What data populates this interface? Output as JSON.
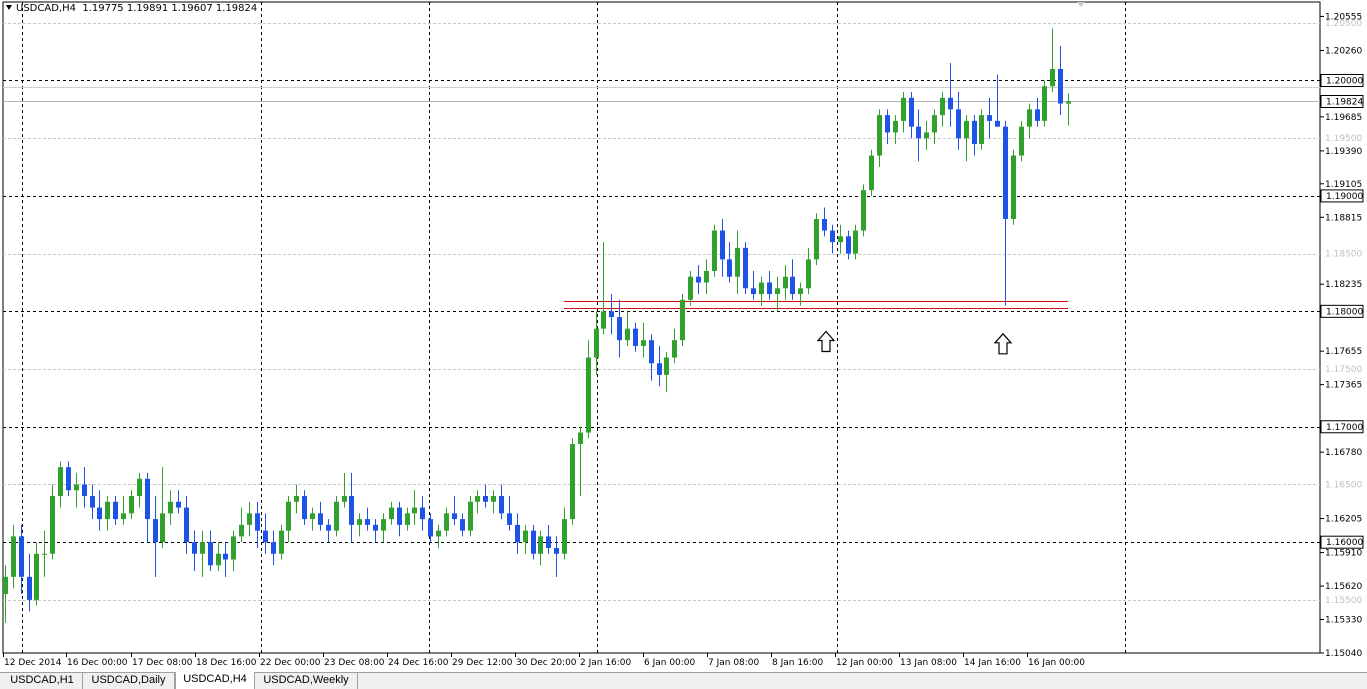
{
  "header": {
    "symbol": "USDCAD,H4",
    "quote": "1.19775 1.19891 1.19607 1.19824"
  },
  "tabs": [
    {
      "label": "USDCAD,H1",
      "active": false
    },
    {
      "label": "USDCAD,Daily",
      "active": false
    },
    {
      "label": "USDCAD,H4",
      "active": true
    },
    {
      "label": "USDCAD,Weekly",
      "active": false
    }
  ],
  "colors": {
    "bull": "#32a02c",
    "bear": "#1f52e6",
    "grid": "#000000",
    "minor_grid": "#c8c8c8",
    "support": "#d01010",
    "current": "#b4b4b4"
  },
  "chart_data": {
    "type": "candlestick",
    "title": "",
    "xlabel": "",
    "ylabel": "",
    "ylim": [
      1.1504,
      1.2068
    ],
    "y_tick_labels": [
      "1.20555",
      "1.20260",
      "1.19685",
      "1.19390",
      "1.19105",
      "1.18815",
      "1.18235",
      "1.17655",
      "1.17365",
      "1.16780",
      "1.16205",
      "1.15910",
      "1.15620",
      "1.15330",
      "1.15040"
    ],
    "y_highlight_labels": [
      "1.20000",
      "1.19000",
      "1.18000",
      "1.17000",
      "1.16000"
    ],
    "y_faint_labels": [
      "1.20500",
      "1.19500",
      "1.18500",
      "1.17500",
      "1.16500",
      "1.15500"
    ],
    "current_price_label": "1.19824",
    "current_price": 1.19824,
    "support_levels": [
      1.1809,
      1.18025
    ],
    "x_tick_labels": [
      "12 Dec 2014",
      "16 Dec 00:00",
      "17 Dec 08:00",
      "18 Dec 16:00",
      "22 Dec 00:00",
      "23 Dec 08:00",
      "24 Dec 16:00",
      "29 Dec 12:00",
      "30 Dec 20:00",
      "2 Jan 16:00",
      "6 Jan 00:00",
      "7 Jan 08:00",
      "8 Jan 16:00",
      "12 Jan 00:00",
      "13 Jan 08:00",
      "14 Jan 16:00",
      "16 Jan 00:00"
    ],
    "annotations": [
      {
        "type": "up-arrow",
        "near": "8 Jan 16:00",
        "price": 1.1773
      },
      {
        "type": "up-arrow",
        "near": "14 Jan 16:00",
        "price": 1.1771
      }
    ],
    "candles": [
      [
        1.1555,
        1.158,
        1.153,
        1.157
      ],
      [
        1.157,
        1.1615,
        1.156,
        1.1605
      ],
      [
        1.1605,
        1.1615,
        1.1555,
        1.157
      ],
      [
        1.157,
        1.159,
        1.154,
        1.155
      ],
      [
        1.155,
        1.16,
        1.1545,
        1.159
      ],
      [
        1.159,
        1.161,
        1.157,
        1.159
      ],
      [
        1.159,
        1.165,
        1.1585,
        1.164
      ],
      [
        1.164,
        1.167,
        1.163,
        1.1665
      ],
      [
        1.1665,
        1.167,
        1.164,
        1.1645
      ],
      [
        1.1645,
        1.166,
        1.163,
        1.165
      ],
      [
        1.165,
        1.1665,
        1.163,
        1.164
      ],
      [
        1.164,
        1.165,
        1.162,
        1.163
      ],
      [
        1.163,
        1.1645,
        1.161,
        1.162
      ],
      [
        1.162,
        1.164,
        1.161,
        1.1635
      ],
      [
        1.1635,
        1.164,
        1.1615,
        1.162
      ],
      [
        1.162,
        1.164,
        1.1615,
        1.1625
      ],
      [
        1.1625,
        1.1645,
        1.162,
        1.164
      ],
      [
        1.164,
        1.166,
        1.163,
        1.1655
      ],
      [
        1.1655,
        1.166,
        1.16,
        1.162
      ],
      [
        1.162,
        1.164,
        1.157,
        1.16
      ],
      [
        1.16,
        1.1665,
        1.1595,
        1.1625
      ],
      [
        1.1625,
        1.1645,
        1.1615,
        1.1635
      ],
      [
        1.1635,
        1.1645,
        1.1625,
        1.163
      ],
      [
        1.163,
        1.164,
        1.159,
        1.16
      ],
      [
        1.16,
        1.161,
        1.1575,
        1.159
      ],
      [
        1.159,
        1.161,
        1.157,
        1.16
      ],
      [
        1.16,
        1.161,
        1.1575,
        1.158
      ],
      [
        1.158,
        1.16,
        1.1575,
        1.159
      ],
      [
        1.159,
        1.16,
        1.157,
        1.1585
      ],
      [
        1.1585,
        1.161,
        1.1575,
        1.1605
      ],
      [
        1.1605,
        1.163,
        1.16,
        1.1615
      ],
      [
        1.1615,
        1.1635,
        1.1605,
        1.1625
      ],
      [
        1.1625,
        1.1635,
        1.1595,
        1.161
      ],
      [
        1.161,
        1.1625,
        1.159,
        1.16
      ],
      [
        1.16,
        1.161,
        1.158,
        1.159
      ],
      [
        1.159,
        1.1615,
        1.1585,
        1.161
      ],
      [
        1.161,
        1.164,
        1.16,
        1.1635
      ],
      [
        1.1635,
        1.165,
        1.1625,
        1.164
      ],
      [
        1.164,
        1.1645,
        1.1615,
        1.162
      ],
      [
        1.162,
        1.163,
        1.161,
        1.1625
      ],
      [
        1.1625,
        1.1635,
        1.161,
        1.1615
      ],
      [
        1.1615,
        1.162,
        1.16,
        1.161
      ],
      [
        1.161,
        1.164,
        1.1605,
        1.1635
      ],
      [
        1.1635,
        1.166,
        1.163,
        1.164
      ],
      [
        1.164,
        1.166,
        1.16,
        1.1615
      ],
      [
        1.1615,
        1.1625,
        1.1605,
        1.162
      ],
      [
        1.162,
        1.163,
        1.161,
        1.1615
      ],
      [
        1.1615,
        1.162,
        1.16,
        1.161
      ],
      [
        1.161,
        1.1625,
        1.16,
        1.162
      ],
      [
        1.162,
        1.1635,
        1.1615,
        1.163
      ],
      [
        1.163,
        1.1635,
        1.1605,
        1.1615
      ],
      [
        1.1615,
        1.163,
        1.161,
        1.1625
      ],
      [
        1.1625,
        1.1645,
        1.1615,
        1.163
      ],
      [
        1.163,
        1.164,
        1.161,
        1.162
      ],
      [
        1.162,
        1.1625,
        1.16,
        1.1605
      ],
      [
        1.1605,
        1.1615,
        1.1595,
        1.161
      ],
      [
        1.161,
        1.163,
        1.1605,
        1.1625
      ],
      [
        1.1625,
        1.164,
        1.1615,
        1.162
      ],
      [
        1.162,
        1.1625,
        1.1605,
        1.161
      ],
      [
        1.161,
        1.164,
        1.1605,
        1.1635
      ],
      [
        1.1635,
        1.1645,
        1.1625,
        1.164
      ],
      [
        1.164,
        1.165,
        1.163,
        1.1635
      ],
      [
        1.1635,
        1.1645,
        1.1625,
        1.164
      ],
      [
        1.164,
        1.165,
        1.162,
        1.1625
      ],
      [
        1.1625,
        1.164,
        1.161,
        1.1615
      ],
      [
        1.1615,
        1.1625,
        1.159,
        1.16
      ],
      [
        1.16,
        1.1615,
        1.159,
        1.161
      ],
      [
        1.161,
        1.1615,
        1.1585,
        1.159
      ],
      [
        1.159,
        1.161,
        1.158,
        1.1605
      ],
      [
        1.1605,
        1.1615,
        1.159,
        1.1595
      ],
      [
        1.1595,
        1.1605,
        1.157,
        1.159
      ],
      [
        1.159,
        1.163,
        1.1585,
        1.162
      ],
      [
        1.162,
        1.169,
        1.1615,
        1.1685
      ],
      [
        1.1685,
        1.17,
        1.164,
        1.1695
      ],
      [
        1.1695,
        1.1775,
        1.169,
        1.176
      ],
      [
        1.176,
        1.18,
        1.1745,
        1.1785
      ],
      [
        1.1785,
        1.186,
        1.178,
        1.18
      ],
      [
        1.18,
        1.1815,
        1.178,
        1.1795
      ],
      [
        1.1795,
        1.181,
        1.176,
        1.1775
      ],
      [
        1.1775,
        1.18,
        1.177,
        1.1785
      ],
      [
        1.1785,
        1.179,
        1.1765,
        1.177
      ],
      [
        1.177,
        1.179,
        1.176,
        1.1775
      ],
      [
        1.1775,
        1.178,
        1.174,
        1.1755
      ],
      [
        1.1755,
        1.177,
        1.1735,
        1.1745
      ],
      [
        1.1745,
        1.1765,
        1.173,
        1.176
      ],
      [
        1.176,
        1.1785,
        1.1755,
        1.1775
      ],
      [
        1.1775,
        1.1815,
        1.177,
        1.181
      ],
      [
        1.181,
        1.1835,
        1.1805,
        1.183
      ],
      [
        1.183,
        1.184,
        1.1815,
        1.1825
      ],
      [
        1.1825,
        1.1845,
        1.1815,
        1.1835
      ],
      [
        1.1835,
        1.1875,
        1.183,
        1.187
      ],
      [
        1.187,
        1.188,
        1.183,
        1.1845
      ],
      [
        1.1845,
        1.186,
        1.1825,
        1.183
      ],
      [
        1.183,
        1.187,
        1.1815,
        1.1855
      ],
      [
        1.1855,
        1.186,
        1.1815,
        1.182
      ],
      [
        1.182,
        1.1835,
        1.181,
        1.1815
      ],
      [
        1.1815,
        1.183,
        1.1805,
        1.1825
      ],
      [
        1.1825,
        1.1835,
        1.181,
        1.1815
      ],
      [
        1.1815,
        1.183,
        1.18,
        1.182
      ],
      [
        1.182,
        1.184,
        1.181,
        1.183
      ],
      [
        1.183,
        1.1845,
        1.181,
        1.1815
      ],
      [
        1.1815,
        1.1825,
        1.1805,
        1.182
      ],
      [
        1.182,
        1.1855,
        1.1815,
        1.1845
      ],
      [
        1.1845,
        1.1885,
        1.184,
        1.188
      ],
      [
        1.188,
        1.189,
        1.1865,
        1.187
      ],
      [
        1.187,
        1.1875,
        1.185,
        1.186
      ],
      [
        1.186,
        1.1875,
        1.185,
        1.1865
      ],
      [
        1.1865,
        1.187,
        1.1845,
        1.185
      ],
      [
        1.185,
        1.1875,
        1.1845,
        1.187
      ],
      [
        1.187,
        1.191,
        1.1865,
        1.1905
      ],
      [
        1.1905,
        1.194,
        1.19,
        1.1935
      ],
      [
        1.1935,
        1.1975,
        1.1925,
        1.197
      ],
      [
        1.197,
        1.1975,
        1.1945,
        1.1955
      ],
      [
        1.1955,
        1.197,
        1.1945,
        1.1965
      ],
      [
        1.1965,
        1.199,
        1.1955,
        1.1985
      ],
      [
        1.1985,
        1.199,
        1.195,
        1.196
      ],
      [
        1.196,
        1.1975,
        1.193,
        1.195
      ],
      [
        1.195,
        1.1965,
        1.194,
        1.1955
      ],
      [
        1.1955,
        1.1975,
        1.1945,
        1.197
      ],
      [
        1.197,
        1.199,
        1.196,
        1.1985
      ],
      [
        1.1985,
        1.2015,
        1.196,
        1.1975
      ],
      [
        1.1975,
        1.199,
        1.194,
        1.195
      ],
      [
        1.195,
        1.197,
        1.193,
        1.1965
      ],
      [
        1.1965,
        1.197,
        1.1935,
        1.1945
      ],
      [
        1.1945,
        1.1975,
        1.194,
        1.197
      ],
      [
        1.197,
        1.1985,
        1.195,
        1.1965
      ],
      [
        1.1965,
        1.2005,
        1.196,
        1.196
      ],
      [
        1.196,
        1.1965,
        1.1805,
        1.188
      ],
      [
        1.188,
        1.194,
        1.1875,
        1.1935
      ],
      [
        1.1935,
        1.1965,
        1.193,
        1.196
      ],
      [
        1.196,
        1.198,
        1.195,
        1.1975
      ],
      [
        1.1975,
        1.1985,
        1.196,
        1.1965
      ],
      [
        1.1965,
        1.2,
        1.196,
        1.1995
      ],
      [
        1.1995,
        1.2045,
        1.199,
        1.201
      ],
      [
        1.201,
        1.203,
        1.197,
        1.198
      ],
      [
        1.198,
        1.1989,
        1.1961,
        1.1982
      ]
    ]
  }
}
